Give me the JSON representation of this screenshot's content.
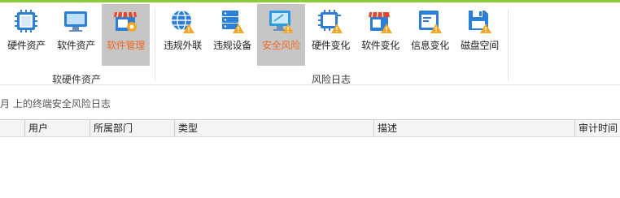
{
  "ribbon": {
    "tools": [
      {
        "label": "硬件资产",
        "icon": "cpu-chip-icon",
        "active": false
      },
      {
        "label": "软件资产",
        "icon": "monitor-icon",
        "active": false
      },
      {
        "label": "软件管理",
        "icon": "store-gear-icon",
        "active": true
      },
      {
        "label": "违规外联",
        "icon": "globe-warning-icon",
        "active": false
      },
      {
        "label": "违规设备",
        "icon": "server-warning-icon",
        "active": false
      },
      {
        "label": "安全风险",
        "icon": "monitor-warning-icon",
        "active": false
      },
      {
        "label": "硬件变化",
        "icon": "cpu-warning-icon",
        "active": false
      },
      {
        "label": "软件变化",
        "icon": "store-warning-icon",
        "active": false
      },
      {
        "label": "信息变化",
        "icon": "window-warning-icon",
        "active": false
      },
      {
        "label": "磁盘空间",
        "icon": "disk-warning-icon",
        "active": false
      }
    ],
    "groups": {
      "assets": "软硬件资产",
      "risk_log": "风险日志"
    }
  },
  "description": "月 上的终端安全风险日志",
  "table": {
    "columns": [
      "",
      "用户",
      "所属部门",
      "类型",
      "描述",
      "审计时间"
    ]
  },
  "colors": {
    "accent": "#8ccc3c",
    "active_label": "#f06a24",
    "active_bg": "#c6c6c6",
    "warning": "#f5a623"
  }
}
